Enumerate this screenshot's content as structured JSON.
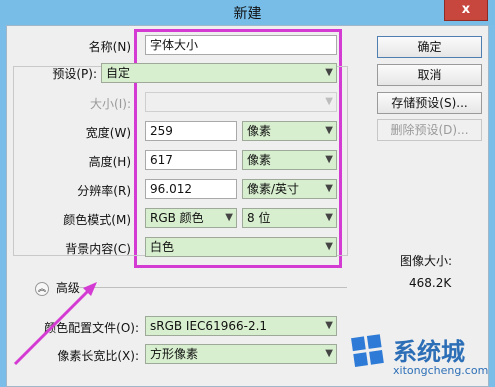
{
  "window": {
    "title": "新建",
    "close_glyph": "x"
  },
  "form": {
    "name": {
      "label": "名称(N)",
      "value": "字体大小"
    },
    "preset": {
      "label": "预设(P):",
      "value": "自定"
    },
    "size": {
      "label": "大小(I):",
      "value": ""
    },
    "width": {
      "label": "宽度(W)",
      "value": "259",
      "unit": "像素"
    },
    "height": {
      "label": "高度(H)",
      "value": "617",
      "unit": "像素"
    },
    "resolution": {
      "label": "分辨率(R)",
      "value": "96.012",
      "unit": "像素/英寸"
    },
    "color_mode": {
      "label": "颜色模式(M)",
      "value": "RGB 颜色",
      "bits": "8 位"
    },
    "background": {
      "label": "背景内容(C)",
      "value": "白色"
    },
    "advanced": {
      "label": "高级"
    },
    "color_profile": {
      "label": "颜色配置文件(O):",
      "value": "sRGB IEC61966-2.1"
    },
    "pixel_aspect": {
      "label": "像素长宽比(X):",
      "value": "方形像素"
    }
  },
  "buttons": {
    "ok": "确定",
    "cancel": "取消",
    "save_preset": "存储预设(S)...",
    "delete_preset": "删除预设(D)..."
  },
  "image_size": {
    "label": "图像大小:",
    "value": "468.2K"
  },
  "watermark": {
    "text": "系统城",
    "url": "xitongcheng.com"
  },
  "colors": {
    "highlight": "#d33bd3",
    "field_green": "#d8efcf",
    "titlebar": "#77bde8"
  }
}
